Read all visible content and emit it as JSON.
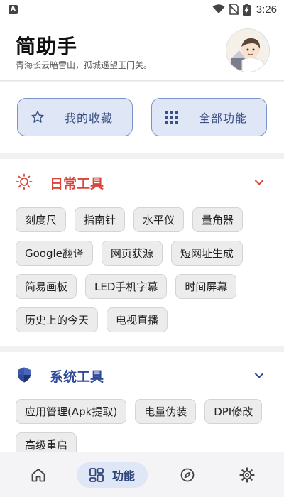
{
  "status_bar": {
    "app_badge": "A",
    "time": "3:26"
  },
  "header": {
    "title": "简助手",
    "subtitle": "青海长云暗雪山，孤城遥望玉门关。"
  },
  "quick_actions": {
    "favorites_label": "我的收藏",
    "all_functions_label": "全部功能"
  },
  "sections": {
    "daily": {
      "title": "日常工具",
      "accent": "#d9453a",
      "tools": [
        "刻度尺",
        "指南针",
        "水平仪",
        "量角器",
        "Google翻译",
        "网页获源",
        "短网址生成",
        "简易画板",
        "LED手机字幕",
        "时间屏幕",
        "历史上的今天",
        "电视直播"
      ]
    },
    "system": {
      "title": "系统工具",
      "accent": "#2f4a9a",
      "tools": [
        "应用管理(Apk提取)",
        "电量伪装",
        "DPI修改",
        "高级重启"
      ]
    }
  },
  "bottom_nav": {
    "home_icon": "home-icon",
    "functions_label": "功能",
    "discover_icon": "compass-icon",
    "settings_icon": "gear-icon"
  },
  "colors": {
    "primary_blue": "#3b4f86",
    "chip_bg": "#ececec",
    "quick_bg": "#dfe6f6"
  }
}
